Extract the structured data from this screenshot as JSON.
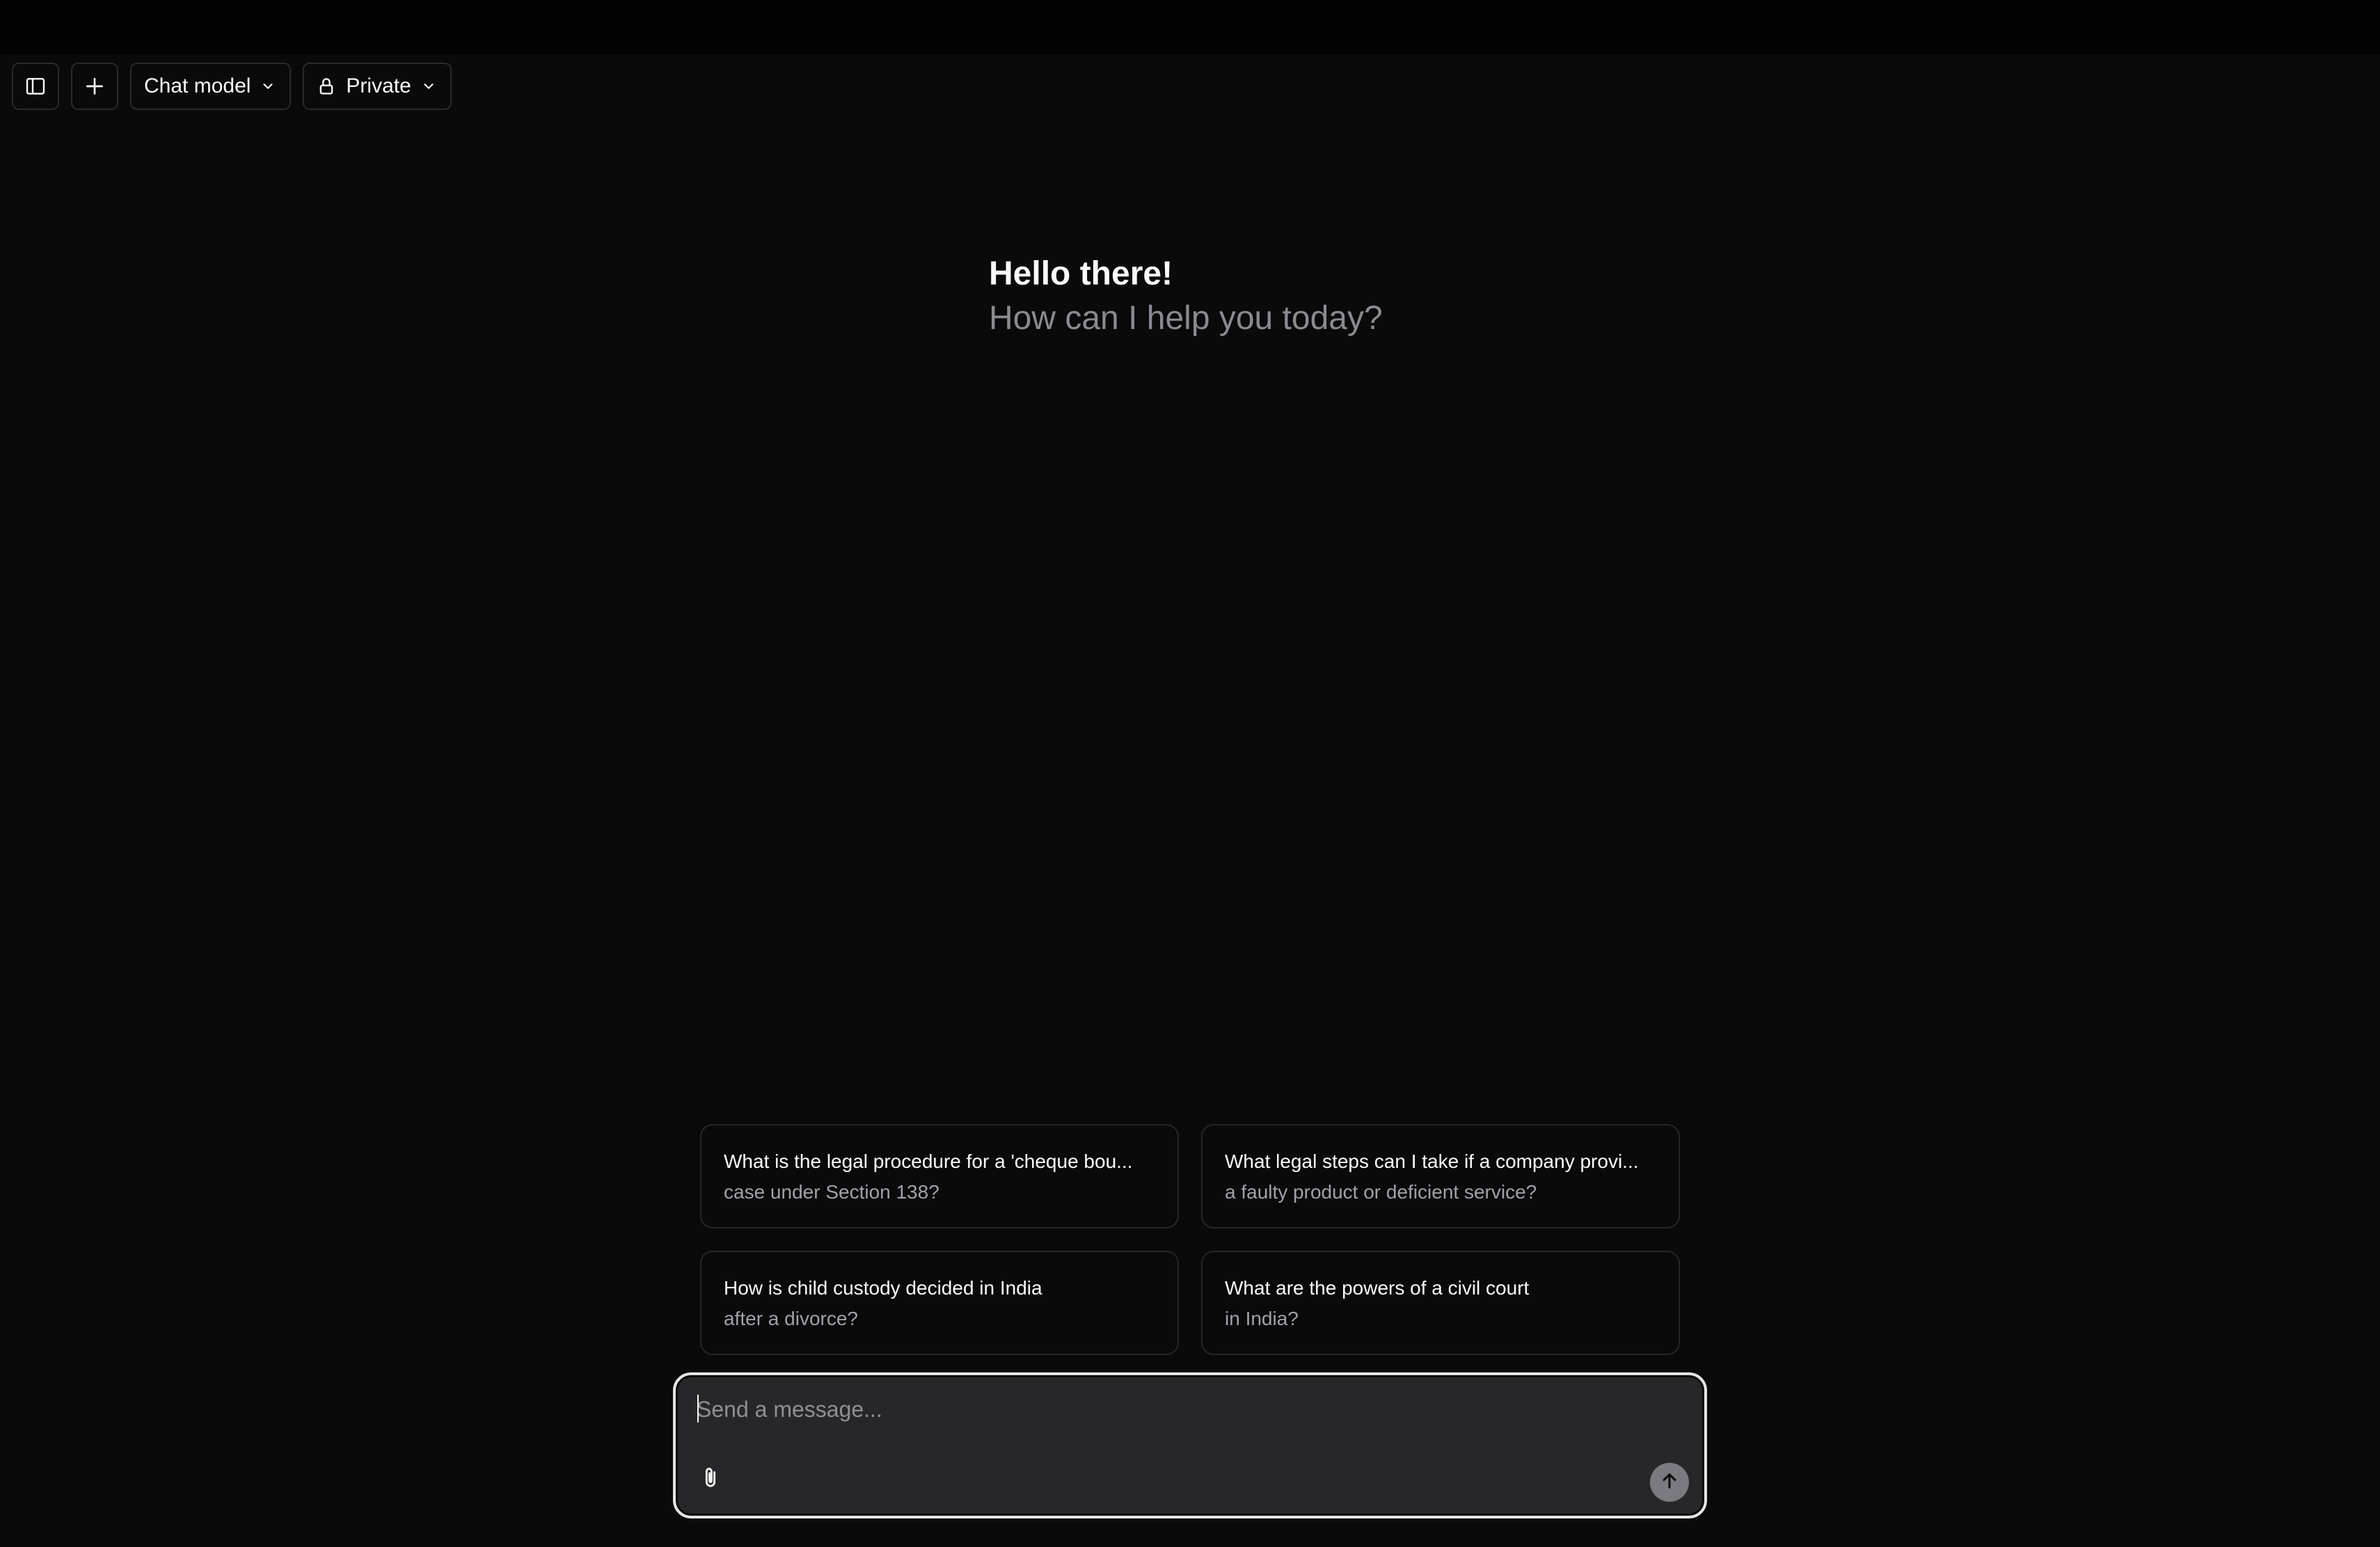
{
  "toolbar": {
    "sidebar_toggle_icon": "sidebar-panel-icon",
    "new_chat_icon": "plus-icon",
    "model_selector_label": "Chat model",
    "visibility_selector_label": "Private",
    "visibility_icon": "lock-icon"
  },
  "greeting": {
    "title": "Hello there!",
    "subtitle": "How can I help you today?"
  },
  "suggestions": [
    {
      "title": "What is the legal procedure for a 'cheque bou...",
      "detail": "case under Section 138?"
    },
    {
      "title": "What legal steps can I take if a company provi...",
      "detail": "a faulty product or deficient service?"
    },
    {
      "title": "How is child custody decided in India",
      "detail": "after a divorce?"
    },
    {
      "title": "What are the powers of a civil court",
      "detail": "in India?"
    }
  ],
  "composer": {
    "placeholder": "Send a message...",
    "value": "",
    "attach_icon": "paperclip-icon",
    "send_icon": "arrow-up-icon"
  },
  "colors": {
    "background": "#0a0a0b",
    "border": "#27272a",
    "muted_text": "#8a8a90",
    "composer_bg": "#27272a",
    "send_button": "#7a7a80"
  }
}
